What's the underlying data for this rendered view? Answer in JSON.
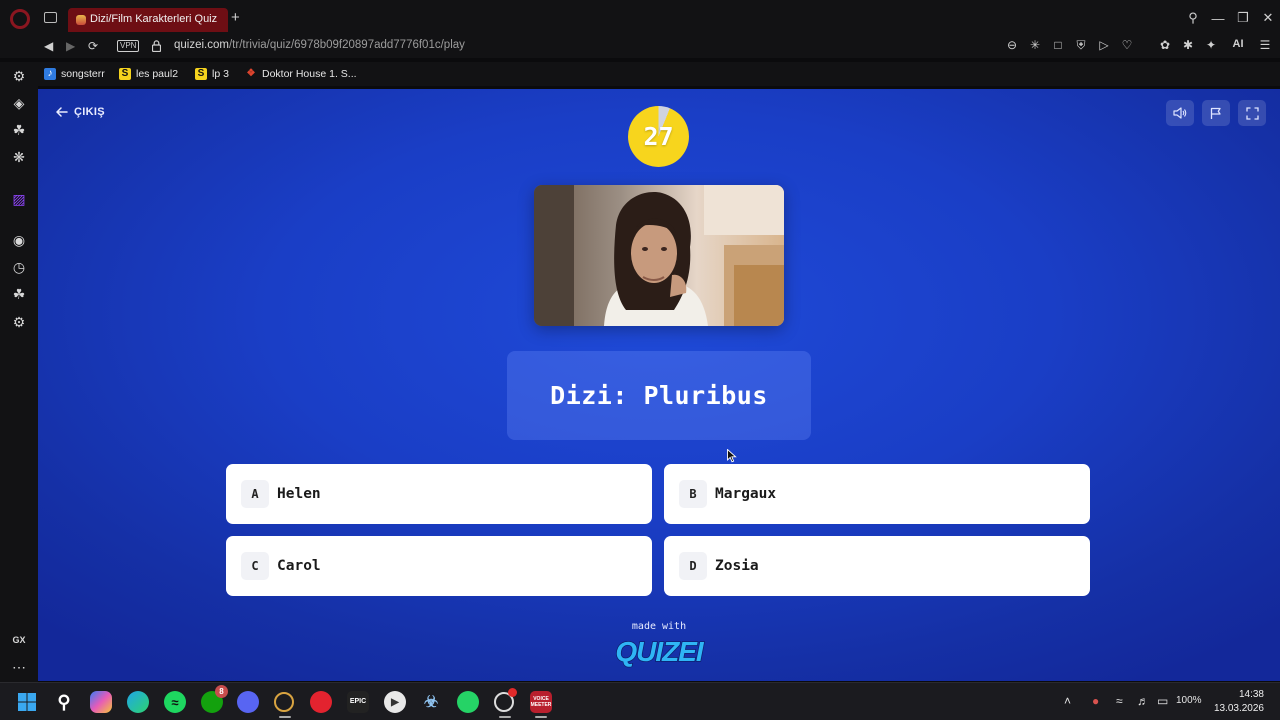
{
  "browser": {
    "tab_title": "Dizi/Film Karakterleri Quiz",
    "vpn_label": "VPN",
    "url_host": "quizei.com",
    "url_path": "/tr/trivia/quiz/6978b09f20897add7776f01c/play",
    "ai_label": "AI",
    "bookmarks": [
      {
        "label": "songsterr",
        "icon": "songsterr-icon"
      },
      {
        "label": "les paul2",
        "icon": "s-icon"
      },
      {
        "label": "lp 3",
        "icon": "s-icon"
      },
      {
        "label": "Doktor House 1. S...",
        "icon": "bookmark-flame-icon"
      }
    ],
    "sidebar_label": "GX"
  },
  "quiz": {
    "exit_label": "ÇIKIŞ",
    "timer": "27",
    "timer_remaining_fraction": 0.94,
    "question": "Dizi: Pluribus",
    "answers": [
      {
        "letter": "A",
        "label": "Helen"
      },
      {
        "letter": "B",
        "label": "Margaux"
      },
      {
        "letter": "C",
        "label": "Carol"
      },
      {
        "letter": "D",
        "label": "Zosia"
      }
    ],
    "made_with": "made with",
    "brand": "QUIZEI"
  },
  "taskbar": {
    "xbox_badge": "8",
    "epic_label": "EPIC",
    "voicemeeter_label": "VOICE MEETER",
    "battery": "100%",
    "time": "14:38",
    "date": "13.03.2026"
  },
  "colors": {
    "page_bg": "#1a3ec6",
    "timer_yellow": "#f7d51d",
    "tab_active": "#6e0e14",
    "answer_bg": "#ffffff"
  }
}
